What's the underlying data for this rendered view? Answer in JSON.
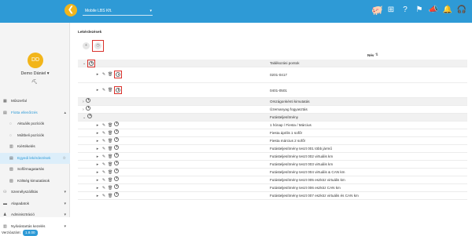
{
  "topbar": {
    "account": "Mobile LBS Kft.",
    "icons": [
      {
        "name": "piggy-bank-icon",
        "glyph": "🐖",
        "badge": ""
      },
      {
        "name": "grid-icon",
        "glyph": "⊞",
        "badge": ""
      },
      {
        "name": "help-icon",
        "glyph": "?",
        "badge": ""
      },
      {
        "name": "flag-icon",
        "glyph": "⚑",
        "badge": "7"
      },
      {
        "name": "megaphone-icon",
        "glyph": "📣",
        "badge": "2"
      },
      {
        "name": "bell-icon",
        "glyph": "🔔",
        "badge": "0"
      },
      {
        "name": "headset-icon",
        "glyph": "🎧",
        "badge": ""
      }
    ]
  },
  "user": {
    "initials": "DD",
    "name": "Demo Dániel"
  },
  "menu": [
    {
      "name": "menu-muszerfal",
      "label": "Műszerfal",
      "icon": "▦",
      "sub": false,
      "chev": ""
    },
    {
      "name": "menu-flotta",
      "label": "Flotta ellenőrzés",
      "icon": "▤",
      "sub": false,
      "chev": "▴",
      "state": "open"
    },
    {
      "name": "menu-aktualis",
      "label": "Aktuális pozíciók",
      "icon": "◌",
      "sub": true,
      "chev": ""
    },
    {
      "name": "menu-multbeli",
      "label": "Múltbeli pozíciók",
      "icon": "◌",
      "sub": true,
      "chev": ""
    },
    {
      "name": "menu-kiertekeles",
      "label": "Kiértékelés",
      "icon": "▥",
      "sub": true,
      "chev": ""
    },
    {
      "name": "menu-egyedi",
      "label": "Egyedi lekérdezések",
      "icon": "▤",
      "sub": true,
      "chev": "",
      "state": "active"
    },
    {
      "name": "menu-sofor",
      "label": "Sofőrmagatartás",
      "icon": "▨",
      "sub": true,
      "chev": ""
    },
    {
      "name": "menu-koltseg",
      "label": "Költség kimutatások",
      "icon": "▧",
      "sub": true,
      "chev": ""
    },
    {
      "name": "menu-szemelyszallitas",
      "label": "Személyszállítás",
      "icon": "⚇",
      "sub": false,
      "chev": "▾"
    },
    {
      "name": "menu-alapadatok",
      "label": "Alapadatok",
      "icon": "▬",
      "sub": false,
      "chev": "▾"
    },
    {
      "name": "menu-adminisztracio",
      "label": "Adminisztráció",
      "icon": "♟",
      "sub": false,
      "chev": "▾"
    },
    {
      "name": "menu-nyilvantartas",
      "label": "Nyilvántartás kezelés",
      "icon": "▥",
      "sub": false,
      "chev": "▾"
    }
  ],
  "version": {
    "label": "Verzióazám:",
    "value": "1.8.00"
  },
  "main": {
    "breadcrumb": "Lekérdezések",
    "column_header": "Név",
    "rows": [
      {
        "label": "Találkozási pontok",
        "alt": true,
        "level": 0,
        "expand": "⌄",
        "hlcol": true
      },
      {
        "label": "0201-0417",
        "alt": false,
        "level": 1,
        "tall": true
      },
      {
        "label": "0401-0501",
        "alt": false,
        "level": 1,
        "tall": true
      },
      {
        "label": "Országonkénti kimutatás",
        "alt": true,
        "level": 0,
        "expand": "›"
      },
      {
        "label": "Üzemanyag fogyasztás",
        "alt": false,
        "level": 0,
        "expand": "›"
      },
      {
        "label": "Futásteljesítmény",
        "alt": true,
        "level": 0,
        "expand": "⌄"
      },
      {
        "label": "1 hónap / Fiesta / Március",
        "alt": false,
        "level": 1
      },
      {
        "label": "Fiesta április 1 sofőr",
        "alt": false,
        "level": 1
      },
      {
        "label": "Fiesta március 2 sofőr",
        "alt": false,
        "level": 1
      },
      {
        "label": "Futásteljesítmény teszt 001 több jármű",
        "alt": false,
        "level": 1
      },
      {
        "label": "Futásteljesítmény teszt 002 virtuális km",
        "alt": false,
        "level": 1
      },
      {
        "label": "Futásteljesítmény teszt 003 virtuális km",
        "alt": false,
        "level": 1
      },
      {
        "label": "Futásteljesítmény teszt 004 virtuális & CAN km",
        "alt": false,
        "level": 1
      },
      {
        "label": "Futásteljesítmény teszt 005 eszköz virtuális km",
        "alt": false,
        "level": 1
      },
      {
        "label": "Futásteljesítmény teszt 006 eszköz CAN km",
        "alt": false,
        "level": 1
      },
      {
        "label": "Futásteljesítmény teszt 007 eszköz virtuális és CAN km",
        "alt": false,
        "level": 1
      }
    ]
  }
}
